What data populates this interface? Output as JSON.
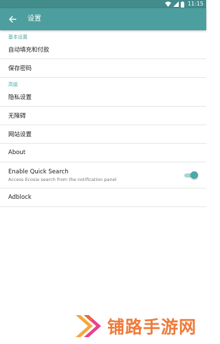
{
  "status_bar": {
    "time": "11:15",
    "background": "#438c8c",
    "icons": [
      "wifi-icon",
      "signal-icon",
      "battery-icon"
    ]
  },
  "app_bar": {
    "title": "设置",
    "back_icon": "arrow-left-icon",
    "background": "#4d9e9e"
  },
  "settings": {
    "sections": [
      {
        "header": "基本设置",
        "items": [
          {
            "label": "自动填充和付款"
          },
          {
            "label": "保存密码"
          }
        ]
      },
      {
        "header": "高级",
        "items": [
          {
            "label": "隐私设置"
          },
          {
            "label": "无障碍"
          },
          {
            "label": "网站设置"
          },
          {
            "label": "About"
          },
          {
            "label": "Enable Quick Search",
            "sublabel": "Access Ecosia search from the notification panel",
            "toggle": true
          },
          {
            "label": "Adblock"
          }
        ]
      }
    ],
    "accent": "#4aaaa8"
  },
  "watermark": {
    "text": "铺路手游网",
    "color": "#ef7a3a"
  }
}
